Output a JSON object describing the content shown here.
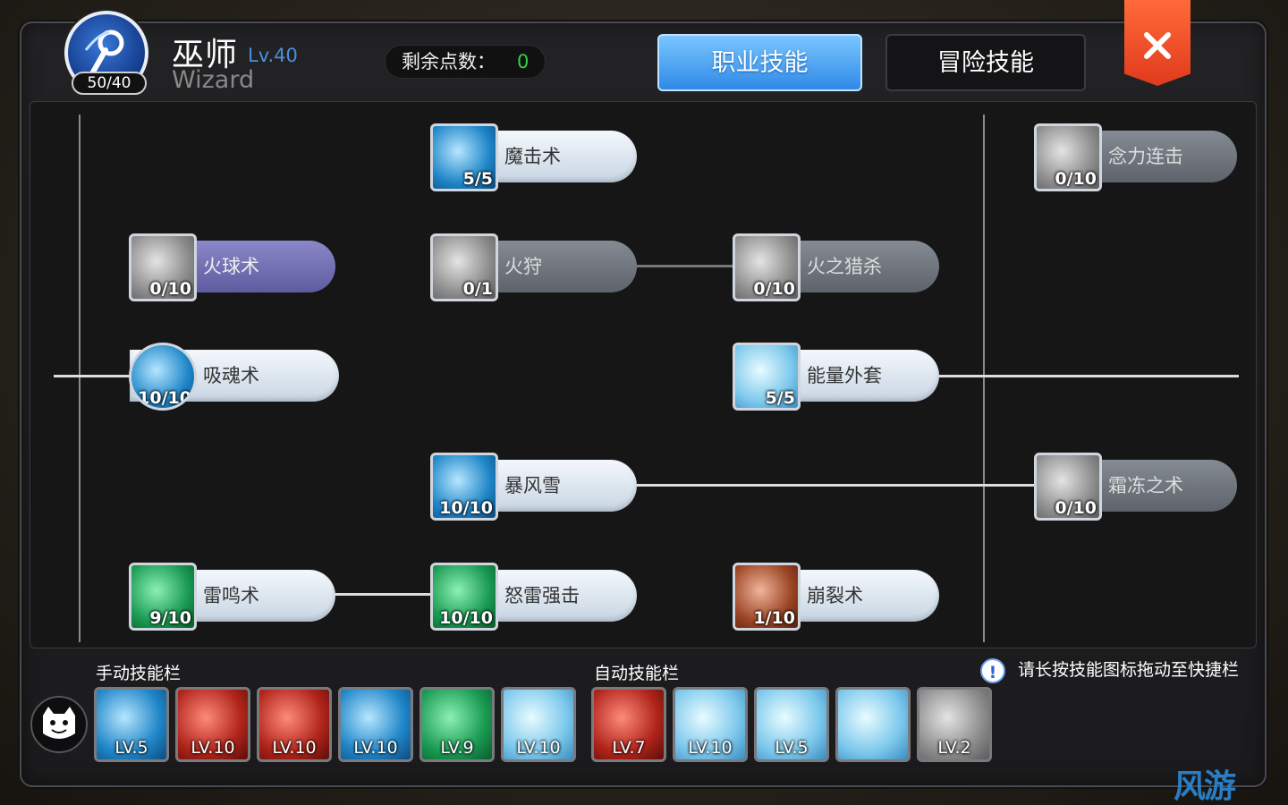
{
  "header": {
    "avatar_count": "50/40",
    "class_name": "巫师",
    "class_level": "Lv.40",
    "class_en": "Wizard",
    "points_label": "剩余点数：",
    "points_value": "0"
  },
  "tabs": [
    {
      "label": "职业技能",
      "active": true
    },
    {
      "label": "冒险技能",
      "active": false
    }
  ],
  "close_icon": "close-x-icon",
  "skills": [
    {
      "name": "魔击术",
      "level": "5/5",
      "state": "active",
      "icon": "magic-strike-icon"
    },
    {
      "name": "念力连击",
      "level": "0/10",
      "state": "locked",
      "icon": "psychic-combo-icon"
    },
    {
      "name": "火球术",
      "level": "0/10",
      "state": "selected",
      "icon": "fireball-icon"
    },
    {
      "name": "火狩",
      "level": "0/1",
      "state": "locked",
      "icon": "fire-hunt-icon"
    },
    {
      "name": "火之猎杀",
      "level": "0/10",
      "state": "locked",
      "icon": "fire-slaughter-icon"
    },
    {
      "name": "吸魂术",
      "level": "10/10",
      "state": "active",
      "icon": "soul-drain-icon"
    },
    {
      "name": "能量外套",
      "level": "5/5",
      "state": "active",
      "icon": "energy-coat-icon"
    },
    {
      "name": "暴风雪",
      "level": "10/10",
      "state": "active",
      "icon": "blizzard-icon"
    },
    {
      "name": "霜冻之术",
      "level": "0/10",
      "state": "locked",
      "icon": "frost-icon"
    },
    {
      "name": "雷鸣术",
      "level": "9/10",
      "state": "active",
      "icon": "thunder-icon"
    },
    {
      "name": "怒雷强击",
      "level": "10/10",
      "state": "active",
      "icon": "thunder-strike-icon"
    },
    {
      "name": "崩裂术",
      "level": "1/10",
      "state": "active",
      "icon": "crack-icon"
    }
  ],
  "manual_bar": {
    "label": "手动技能栏",
    "slots": [
      "LV.5",
      "LV.10",
      "LV.10",
      "LV.10",
      "LV.9",
      "LV.10"
    ]
  },
  "auto_bar": {
    "label": "自动技能栏",
    "slots": [
      "LV.7",
      "LV.10",
      "LV.5",
      "",
      "LV.2"
    ]
  },
  "hint": "请长按技能图标拖动至快捷栏",
  "watermark": "风游"
}
